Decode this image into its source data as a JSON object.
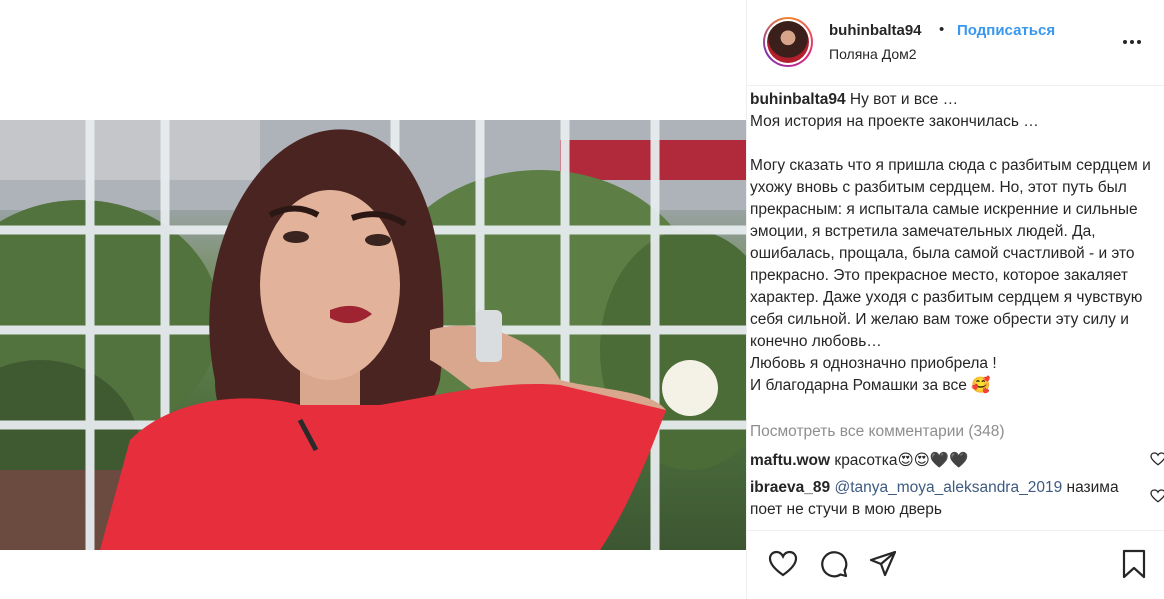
{
  "header": {
    "username": "buhinbalta94",
    "separator": "•",
    "follow_label": "Подписаться",
    "location": "Поляна Дом2"
  },
  "caption": {
    "username": "buhinbalta94",
    "text": "Ну вот и все …\nМоя история на проекте закончилась …\n\nМогу сказать что я пришла сюда с разбитым сердцем и ухожу вновь с разбитым сердцем. Но, этот путь был прекрасным: я испытала самые искренние и сильные эмоции, я встретила замечательных людей. Да, ошибалась, прощала, была самой счастливой - и это прекрасно. Это прекрасное место, которое закаляет характер. Даже уходя с разбитым сердцем я чувствую себя сильной. И желаю вам тоже обрести эту силу и конечно любовь…\nЛюбовь я однозначно приобрела !\nИ благодарна Ромашки за все 🥰"
  },
  "comments": {
    "view_all_label": "Посмотреть все комментарии (348)",
    "items": [
      {
        "username": "maftu.wow",
        "mention": "",
        "text": "красотка😍😍🖤🖤"
      },
      {
        "username": "ibraeva_89",
        "mention": "@tanya_moya_aleksandra_2019",
        "text": "назима поет не стучи в мою дверь"
      }
    ]
  },
  "icons": {
    "like": "heart-icon",
    "comment": "comment-icon",
    "share": "paper-plane-icon",
    "save": "bookmark-icon",
    "more": "more-options-icon"
  },
  "colors": {
    "accent": "#3897f0",
    "text": "#262626",
    "muted": "#8e8e8e"
  }
}
